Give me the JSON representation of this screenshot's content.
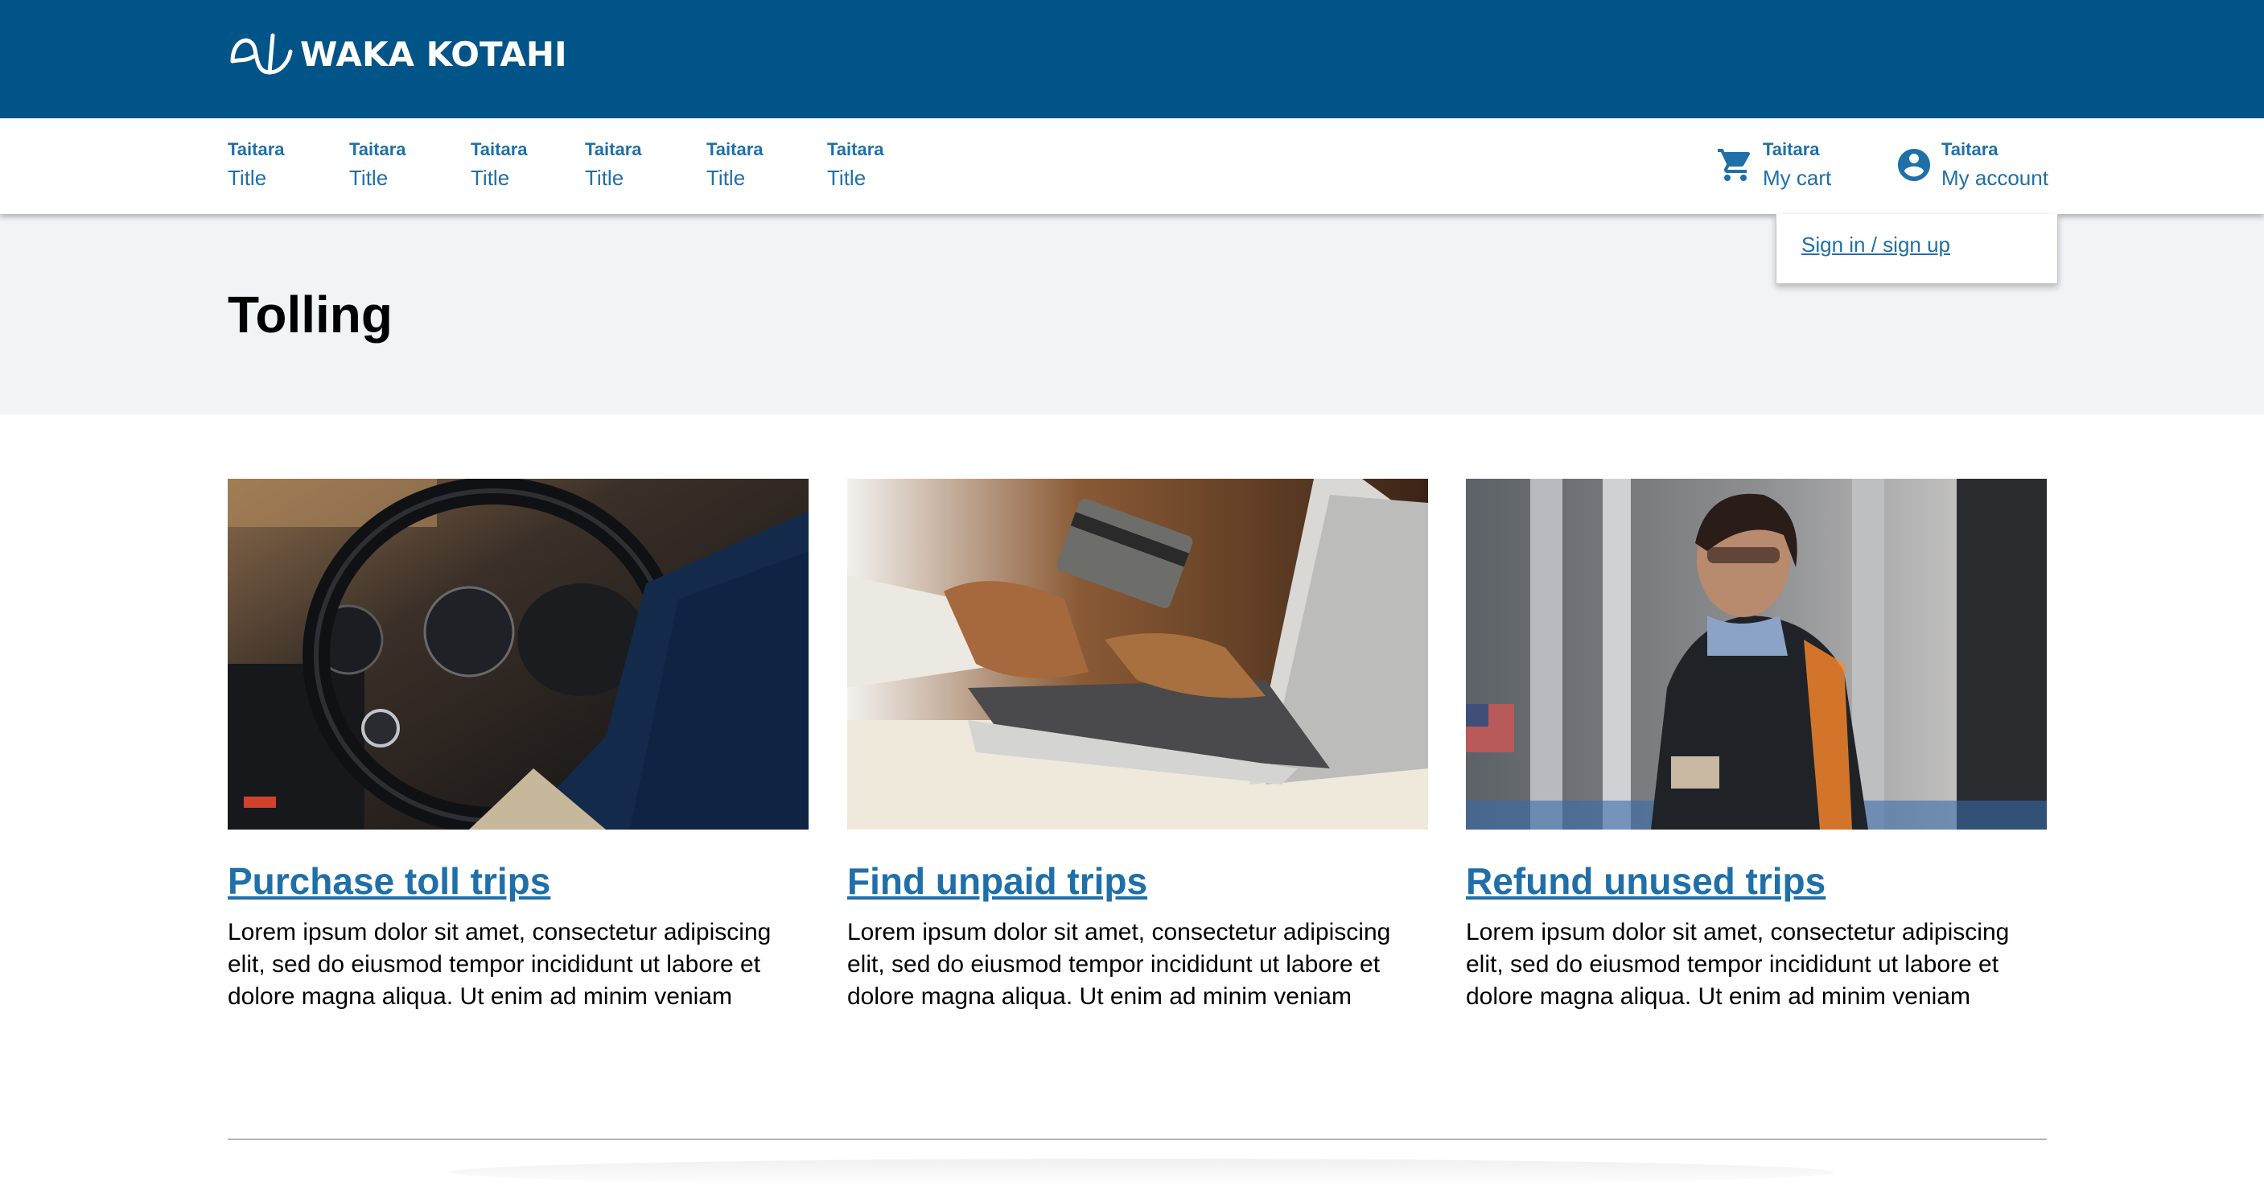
{
  "brand": {
    "name": "WAKA KOTAHI",
    "bar_color": "#005488",
    "logo_icon": "waka-kotahi-logo-icon"
  },
  "nav": {
    "items": [
      {
        "small": "Taitara",
        "label": "Title"
      },
      {
        "small": "Taitara",
        "label": "Title"
      },
      {
        "small": "Taitara",
        "label": "Title"
      },
      {
        "small": "Taitara",
        "label": "Title"
      },
      {
        "small": "Taitara",
        "label": "Title"
      },
      {
        "small": "Taitara",
        "label": "Title"
      }
    ],
    "cart": {
      "small": "Taitara",
      "label": "My cart",
      "icon": "shopping-cart-icon"
    },
    "account": {
      "small": "Taitara",
      "label": "My account",
      "icon": "account-circle-icon"
    },
    "link_color": "#1f6fa8"
  },
  "account_dropdown": {
    "sign_in_label": "Sign in / sign up"
  },
  "page": {
    "title": "Tolling",
    "band_color": "#f2f3f6"
  },
  "cards": [
    {
      "title": "Purchase toll trips",
      "body": "Lorem ipsum dolor sit amet, consectetur adipiscing elit, sed do eiusmod tempor incididunt ut labore et dolore magna aliqua. Ut enim ad minim veniam",
      "image": "car-steering-wheel-photo"
    },
    {
      "title": "Find unpaid trips",
      "body": "Lorem ipsum dolor sit amet, consectetur adipiscing elit, sed do eiusmod tempor incididunt ut labore et dolore magna aliqua. Ut enim ad minim veniam",
      "image": "credit-card-laptop-photo"
    },
    {
      "title": "Refund unused trips",
      "body": "Lorem ipsum dolor sit amet, consectetur adipiscing elit, sed do eiusmod tempor incididunt ut labore et dolore magna aliqua. Ut enim ad minim veniam",
      "image": "toll-booth-attendant-photo"
    }
  ]
}
